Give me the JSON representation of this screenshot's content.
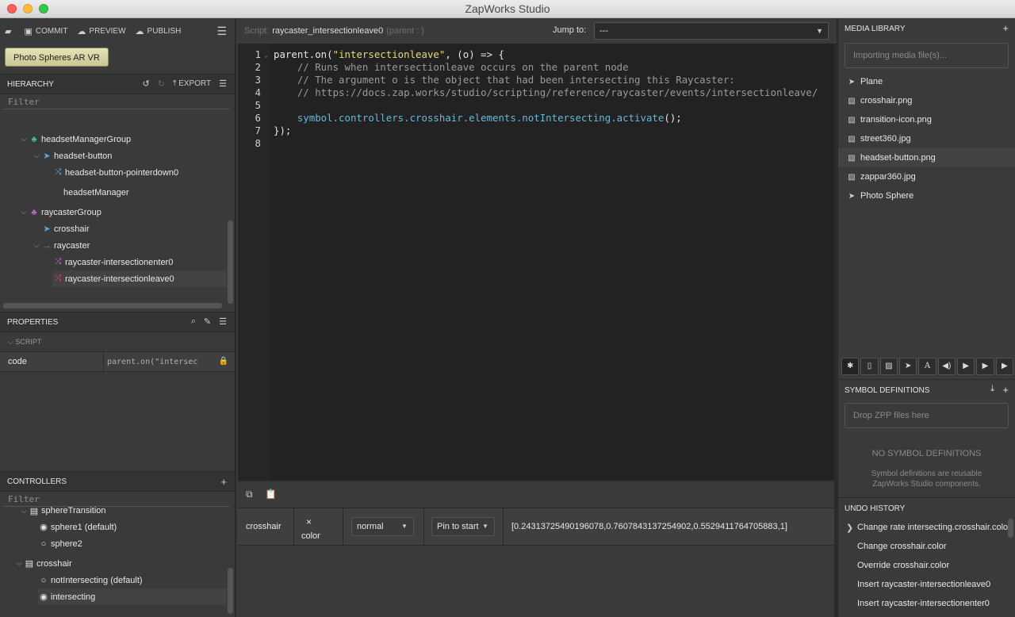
{
  "window": {
    "title": "ZapWorks Studio"
  },
  "toolbar": {
    "commit": "COMMIT",
    "preview": "PREVIEW",
    "publish": "PUBLISH"
  },
  "project": {
    "name": "Photo Spheres AR VR"
  },
  "hierarchy": {
    "title": "HIERARCHY",
    "export": "EXPORT",
    "filter_placeholder": "Filter",
    "items": [
      {
        "label": "headsetManagerGroup",
        "icon": "group-icon",
        "color": "#3fc59a"
      },
      {
        "label": "headset-button",
        "icon": "rocket-icon",
        "color": "#5aa9e6"
      },
      {
        "label": "headset-button-pointerdown0",
        "icon": "shuffle-icon",
        "color": "#5aa9e6"
      },
      {
        "label": "headsetManager",
        "icon": "",
        "color": ""
      },
      {
        "label": "raycasterGroup",
        "icon": "group-icon",
        "color": "#c266c9"
      },
      {
        "label": "crosshair",
        "icon": "rocket-icon",
        "color": "#5aa9e6"
      },
      {
        "label": "raycaster",
        "icon": "arrow-icon",
        "color": "#e0506a"
      },
      {
        "label": "raycaster-intersectionenter0",
        "icon": "shuffle-icon",
        "color": "#c266c9"
      },
      {
        "label": "raycaster-intersectionleave0",
        "icon": "shuffle-icon",
        "color": "#e0506a"
      }
    ]
  },
  "properties": {
    "title": "PROPERTIES",
    "section": "SCRIPT",
    "key": "code",
    "value": "parent.on(\"intersec"
  },
  "controllers": {
    "title": "CONTROLLERS",
    "filter_placeholder": "Filter",
    "items": [
      {
        "label": "sphereTransition"
      },
      {
        "label": "sphere1 (default)"
      },
      {
        "label": "sphere2"
      },
      {
        "label": "crosshair"
      },
      {
        "label": "notIntersecting (default)"
      },
      {
        "label": "intersecting"
      }
    ]
  },
  "script": {
    "label": "Script:",
    "name": "raycaster_intersectionleave0",
    "parent": "(parent : )",
    "jump_label": "Jump to:",
    "jump_value": "---",
    "line_numbers": [
      "1",
      "2",
      "3",
      "4",
      "5",
      "6",
      "7",
      "8"
    ],
    "lines": {
      "l1a": "parent.on(",
      "l1b": "\"intersectionleave\"",
      "l1c": ", (o) => {",
      "l2": "    // Runs when intersectionleave occurs on the parent node",
      "l3": "    // The argument o is the object that had been intersecting this Raycaster:",
      "l4": "    // https://docs.zap.works/studio/scripting/reference/raycaster/events/intersectionleave/",
      "l6a": "    symbol.controllers.crosshair.elements.notIntersecting.activate",
      "l6b": "();",
      "l7": "});"
    }
  },
  "timeline": {
    "node": "crosshair",
    "prop": "color",
    "close_icon": "×",
    "blend": "normal",
    "pin": "Pin to start",
    "value": "[0.24313725490196078,0.7607843137254902,0.5529411764705883,1]"
  },
  "media": {
    "title": "MEDIA LIBRARY",
    "drop": "Importing media file(s)...",
    "items": [
      {
        "label": "Plane",
        "icon": "rocket-icon"
      },
      {
        "label": "crosshair.png",
        "icon": "image-icon"
      },
      {
        "label": "transition-icon.png",
        "icon": "image-icon"
      },
      {
        "label": "street360.jpg",
        "icon": "image-icon"
      },
      {
        "label": "headset-button.png",
        "icon": "image-icon"
      },
      {
        "label": "zappar360.jpg",
        "icon": "image-icon"
      },
      {
        "label": "Photo Sphere",
        "icon": "rocket-icon"
      }
    ]
  },
  "symbols": {
    "title": "SYMBOL DEFINITIONS",
    "drop": "Drop ZPP files here",
    "empty_title": "NO SYMBOL DEFINITIONS",
    "empty_line1": "Symbol definitions are reusable",
    "empty_line2": "ZapWorks Studio components."
  },
  "undo": {
    "title": "UNDO HISTORY",
    "items": [
      "Change rate intersecting.crosshair.color",
      "Change crosshair.color",
      "Override crosshair.color",
      "Insert raycaster-intersectionleave0",
      "Insert raycaster-intersectionenter0"
    ]
  }
}
